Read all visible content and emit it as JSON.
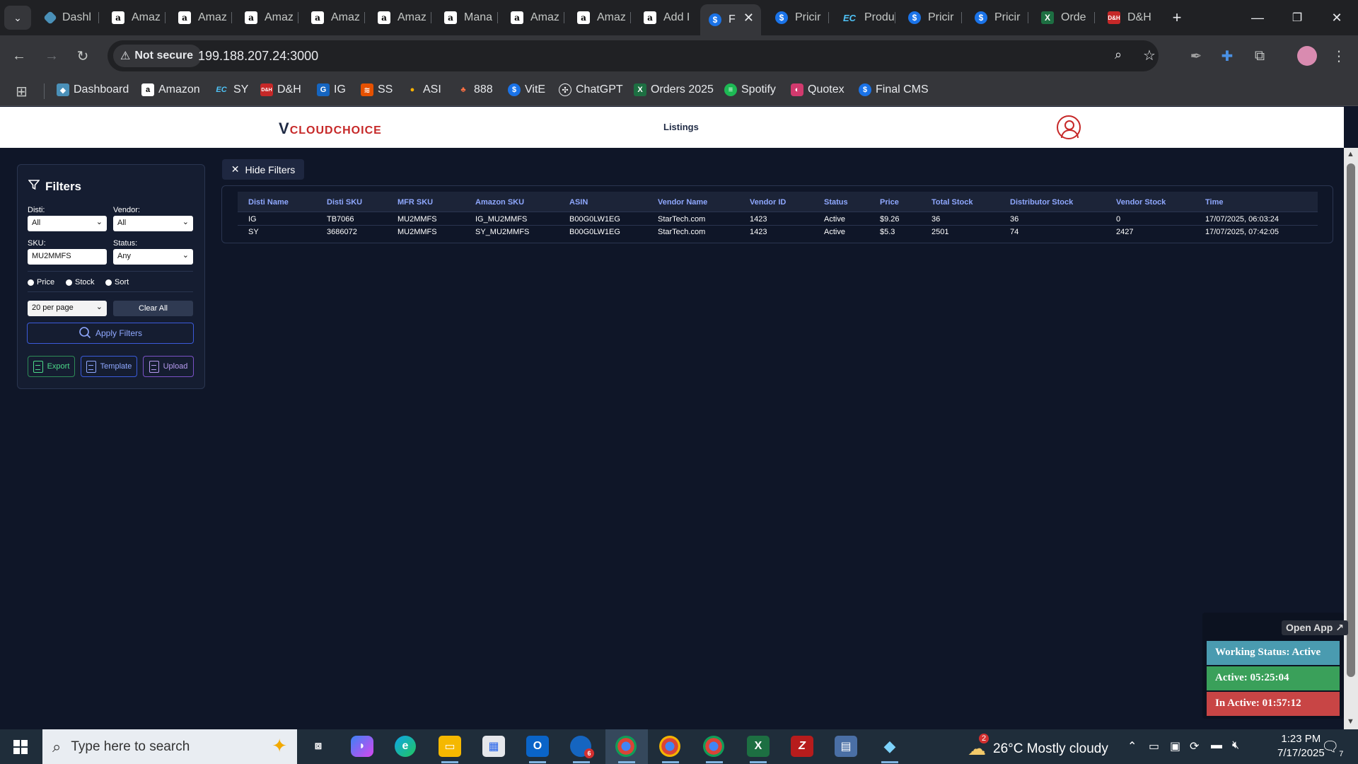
{
  "browser": {
    "tabs": [
      {
        "label": "Dashl",
        "icon": "dashboard-icon"
      },
      {
        "label": "Amaz",
        "icon": "amazon-icon"
      },
      {
        "label": "Amaz",
        "icon": "amazon-icon"
      },
      {
        "label": "Amaz",
        "icon": "amazon-icon"
      },
      {
        "label": "Amaz",
        "icon": "amazon-icon"
      },
      {
        "label": "Amaz",
        "icon": "amazon-icon"
      },
      {
        "label": "Mana",
        "icon": "amazon-icon"
      },
      {
        "label": "Amaz",
        "icon": "amazon-icon"
      },
      {
        "label": "Amaz",
        "icon": "amazon-icon"
      },
      {
        "label": "Add I",
        "icon": "amazon-icon"
      },
      {
        "label": "F",
        "icon": "dollar-icon",
        "active": true
      },
      {
        "label": "Pricir",
        "icon": "dollar-icon"
      },
      {
        "label": "Produ",
        "icon": "ec-icon"
      },
      {
        "label": "Pricir",
        "icon": "dollar-icon"
      },
      {
        "label": "Pricir",
        "icon": "dollar-icon"
      },
      {
        "label": "Orde",
        "icon": "excel-icon"
      },
      {
        "label": "D&H",
        "icon": "dh-icon"
      }
    ],
    "security": "Not secure",
    "url": "199.188.207.24:3000",
    "bookmarks": [
      {
        "label": "Dashboard",
        "icon": "dashboard-icon"
      },
      {
        "label": "Amazon",
        "icon": "amazon-icon"
      },
      {
        "label": "SY",
        "icon": "ec-icon"
      },
      {
        "label": "D&H",
        "icon": "dh-icon"
      },
      {
        "label": "IG",
        "icon": "ig-icon"
      },
      {
        "label": "SS",
        "icon": "ss-icon"
      },
      {
        "label": "ASI",
        "icon": "asi-icon"
      },
      {
        "label": "888",
        "icon": "888-icon"
      },
      {
        "label": "VitE",
        "icon": "dollar-icon"
      },
      {
        "label": "ChatGPT",
        "icon": "chatgpt-icon"
      },
      {
        "label": "Orders 2025",
        "icon": "excel-icon"
      },
      {
        "label": "Spotify",
        "icon": "spotify-icon"
      },
      {
        "label": "Quotex",
        "icon": "quotex-icon"
      },
      {
        "label": "Final CMS",
        "icon": "dollar-icon"
      }
    ]
  },
  "app": {
    "logo": {
      "mark": "V",
      "text": "CLOUDCHOICE"
    },
    "nav": "Listings"
  },
  "filters": {
    "title": "Filters",
    "disti_label": "Disti:",
    "disti_value": "All",
    "vendor_label": "Vendor:",
    "vendor_value": "All",
    "sku_label": "SKU:",
    "sku_value": "MU2MMFS",
    "status_label": "Status:",
    "status_value": "Any",
    "radios": [
      "Price",
      "Stock",
      "Sort"
    ],
    "per_page": "20 per page",
    "clear_all": "Clear All",
    "apply": "Apply Filters",
    "export": "Export",
    "template": "Template",
    "upload": "Upload"
  },
  "hide_filters": "Hide Filters",
  "table": {
    "columns": [
      "Disti Name",
      "Disti SKU",
      "MFR SKU",
      "Amazon SKU",
      "ASIN",
      "Vendor Name",
      "Vendor ID",
      "Status",
      "Price",
      "Total Stock",
      "Distributor Stock",
      "Vendor Stock",
      "Time"
    ],
    "rows": [
      [
        "IG",
        "TB7066",
        "MU2MMFS",
        "IG_MU2MMFS",
        "B00G0LW1EG",
        "StarTech.com",
        "1423",
        "Active",
        "$9.26",
        "36",
        "36",
        "0",
        "17/07/2025, 06:03:24"
      ],
      [
        "SY",
        "3686072",
        "MU2MMFS",
        "SY_MU2MMFS",
        "B00G0LW1EG",
        "StarTech.com",
        "1423",
        "Active",
        "$5.3",
        "2501",
        "74",
        "2427",
        "17/07/2025, 07:42:05"
      ]
    ]
  },
  "tracker": {
    "open_app": "Open App ↗",
    "working_status": "Working Status: Active",
    "active": "Active: 05:25:04",
    "inactive": "In Active: 01:57:12",
    "colors": {
      "working": "#4a9bb0",
      "active": "#3aa05a",
      "inactive": "#c84545"
    }
  },
  "taskbar": {
    "search_placeholder": "Type here to search",
    "weather": "26°C Mostly cloudy",
    "weather_badge": "2",
    "time": "1:23 PM",
    "date": "7/17/2025",
    "notifications": "7",
    "outlook_badge": "6"
  }
}
